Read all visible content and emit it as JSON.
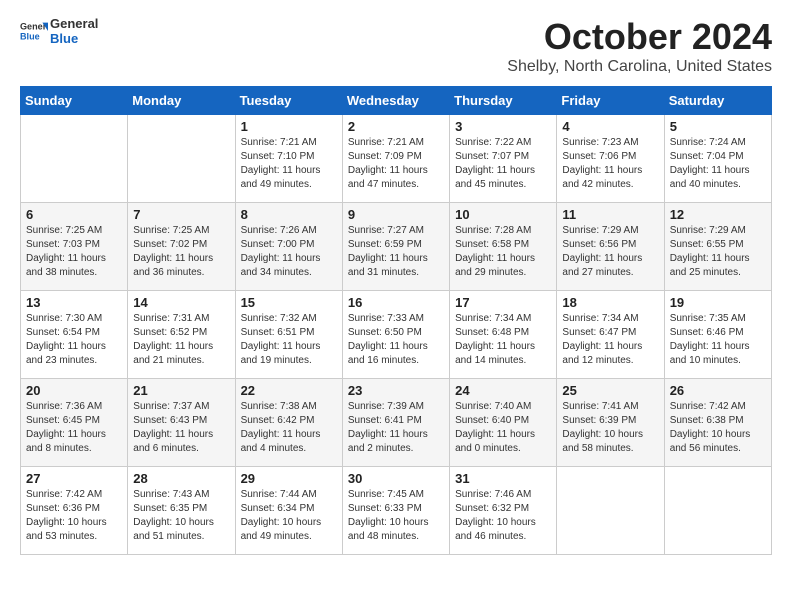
{
  "header": {
    "logo_general": "General",
    "logo_blue": "Blue",
    "month_title": "October 2024",
    "location": "Shelby, North Carolina, United States"
  },
  "days_of_week": [
    "Sunday",
    "Monday",
    "Tuesday",
    "Wednesday",
    "Thursday",
    "Friday",
    "Saturday"
  ],
  "weeks": [
    [
      {
        "day": "",
        "info": ""
      },
      {
        "day": "",
        "info": ""
      },
      {
        "day": "1",
        "sunrise": "Sunrise: 7:21 AM",
        "sunset": "Sunset: 7:10 PM",
        "daylight": "Daylight: 11 hours and 49 minutes."
      },
      {
        "day": "2",
        "sunrise": "Sunrise: 7:21 AM",
        "sunset": "Sunset: 7:09 PM",
        "daylight": "Daylight: 11 hours and 47 minutes."
      },
      {
        "day": "3",
        "sunrise": "Sunrise: 7:22 AM",
        "sunset": "Sunset: 7:07 PM",
        "daylight": "Daylight: 11 hours and 45 minutes."
      },
      {
        "day": "4",
        "sunrise": "Sunrise: 7:23 AM",
        "sunset": "Sunset: 7:06 PM",
        "daylight": "Daylight: 11 hours and 42 minutes."
      },
      {
        "day": "5",
        "sunrise": "Sunrise: 7:24 AM",
        "sunset": "Sunset: 7:04 PM",
        "daylight": "Daylight: 11 hours and 40 minutes."
      }
    ],
    [
      {
        "day": "6",
        "sunrise": "Sunrise: 7:25 AM",
        "sunset": "Sunset: 7:03 PM",
        "daylight": "Daylight: 11 hours and 38 minutes."
      },
      {
        "day": "7",
        "sunrise": "Sunrise: 7:25 AM",
        "sunset": "Sunset: 7:02 PM",
        "daylight": "Daylight: 11 hours and 36 minutes."
      },
      {
        "day": "8",
        "sunrise": "Sunrise: 7:26 AM",
        "sunset": "Sunset: 7:00 PM",
        "daylight": "Daylight: 11 hours and 34 minutes."
      },
      {
        "day": "9",
        "sunrise": "Sunrise: 7:27 AM",
        "sunset": "Sunset: 6:59 PM",
        "daylight": "Daylight: 11 hours and 31 minutes."
      },
      {
        "day": "10",
        "sunrise": "Sunrise: 7:28 AM",
        "sunset": "Sunset: 6:58 PM",
        "daylight": "Daylight: 11 hours and 29 minutes."
      },
      {
        "day": "11",
        "sunrise": "Sunrise: 7:29 AM",
        "sunset": "Sunset: 6:56 PM",
        "daylight": "Daylight: 11 hours and 27 minutes."
      },
      {
        "day": "12",
        "sunrise": "Sunrise: 7:29 AM",
        "sunset": "Sunset: 6:55 PM",
        "daylight": "Daylight: 11 hours and 25 minutes."
      }
    ],
    [
      {
        "day": "13",
        "sunrise": "Sunrise: 7:30 AM",
        "sunset": "Sunset: 6:54 PM",
        "daylight": "Daylight: 11 hours and 23 minutes."
      },
      {
        "day": "14",
        "sunrise": "Sunrise: 7:31 AM",
        "sunset": "Sunset: 6:52 PM",
        "daylight": "Daylight: 11 hours and 21 minutes."
      },
      {
        "day": "15",
        "sunrise": "Sunrise: 7:32 AM",
        "sunset": "Sunset: 6:51 PM",
        "daylight": "Daylight: 11 hours and 19 minutes."
      },
      {
        "day": "16",
        "sunrise": "Sunrise: 7:33 AM",
        "sunset": "Sunset: 6:50 PM",
        "daylight": "Daylight: 11 hours and 16 minutes."
      },
      {
        "day": "17",
        "sunrise": "Sunrise: 7:34 AM",
        "sunset": "Sunset: 6:48 PM",
        "daylight": "Daylight: 11 hours and 14 minutes."
      },
      {
        "day": "18",
        "sunrise": "Sunrise: 7:34 AM",
        "sunset": "Sunset: 6:47 PM",
        "daylight": "Daylight: 11 hours and 12 minutes."
      },
      {
        "day": "19",
        "sunrise": "Sunrise: 7:35 AM",
        "sunset": "Sunset: 6:46 PM",
        "daylight": "Daylight: 11 hours and 10 minutes."
      }
    ],
    [
      {
        "day": "20",
        "sunrise": "Sunrise: 7:36 AM",
        "sunset": "Sunset: 6:45 PM",
        "daylight": "Daylight: 11 hours and 8 minutes."
      },
      {
        "day": "21",
        "sunrise": "Sunrise: 7:37 AM",
        "sunset": "Sunset: 6:43 PM",
        "daylight": "Daylight: 11 hours and 6 minutes."
      },
      {
        "day": "22",
        "sunrise": "Sunrise: 7:38 AM",
        "sunset": "Sunset: 6:42 PM",
        "daylight": "Daylight: 11 hours and 4 minutes."
      },
      {
        "day": "23",
        "sunrise": "Sunrise: 7:39 AM",
        "sunset": "Sunset: 6:41 PM",
        "daylight": "Daylight: 11 hours and 2 minutes."
      },
      {
        "day": "24",
        "sunrise": "Sunrise: 7:40 AM",
        "sunset": "Sunset: 6:40 PM",
        "daylight": "Daylight: 11 hours and 0 minutes."
      },
      {
        "day": "25",
        "sunrise": "Sunrise: 7:41 AM",
        "sunset": "Sunset: 6:39 PM",
        "daylight": "Daylight: 10 hours and 58 minutes."
      },
      {
        "day": "26",
        "sunrise": "Sunrise: 7:42 AM",
        "sunset": "Sunset: 6:38 PM",
        "daylight": "Daylight: 10 hours and 56 minutes."
      }
    ],
    [
      {
        "day": "27",
        "sunrise": "Sunrise: 7:42 AM",
        "sunset": "Sunset: 6:36 PM",
        "daylight": "Daylight: 10 hours and 53 minutes."
      },
      {
        "day": "28",
        "sunrise": "Sunrise: 7:43 AM",
        "sunset": "Sunset: 6:35 PM",
        "daylight": "Daylight: 10 hours and 51 minutes."
      },
      {
        "day": "29",
        "sunrise": "Sunrise: 7:44 AM",
        "sunset": "Sunset: 6:34 PM",
        "daylight": "Daylight: 10 hours and 49 minutes."
      },
      {
        "day": "30",
        "sunrise": "Sunrise: 7:45 AM",
        "sunset": "Sunset: 6:33 PM",
        "daylight": "Daylight: 10 hours and 48 minutes."
      },
      {
        "day": "31",
        "sunrise": "Sunrise: 7:46 AM",
        "sunset": "Sunset: 6:32 PM",
        "daylight": "Daylight: 10 hours and 46 minutes."
      },
      {
        "day": "",
        "info": ""
      },
      {
        "day": "",
        "info": ""
      }
    ]
  ]
}
